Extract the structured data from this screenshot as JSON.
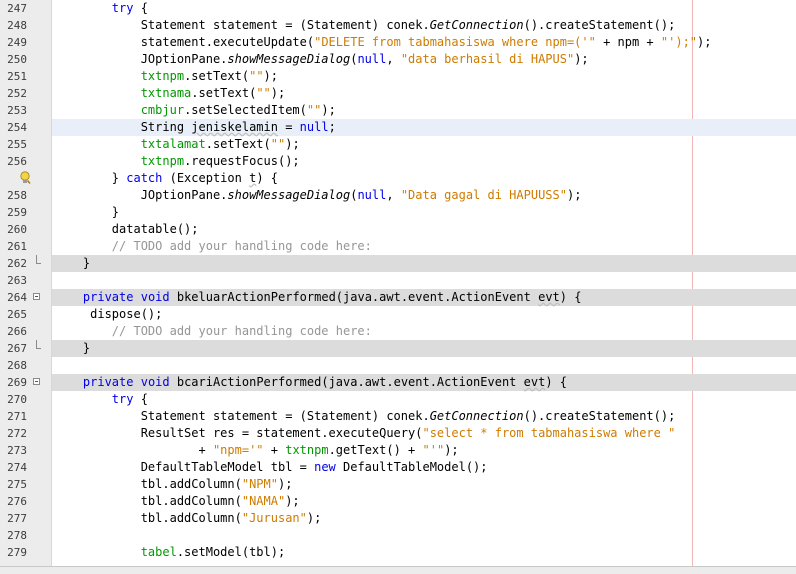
{
  "editor": {
    "lines": [
      {
        "num": "247",
        "fold": "",
        "hl": "",
        "segments": [
          {
            "t": "        "
          },
          {
            "t": "try",
            "c": "kw"
          },
          {
            "t": " {"
          }
        ]
      },
      {
        "num": "248",
        "fold": "",
        "hl": "",
        "segments": [
          {
            "t": "            Statement statement = (Statement) conek."
          },
          {
            "t": "GetConnection",
            "c": "ital"
          },
          {
            "t": "().createStatement();"
          }
        ]
      },
      {
        "num": "249",
        "fold": "",
        "hl": "",
        "segments": [
          {
            "t": "            statement.executeUpdate("
          },
          {
            "t": "\"DELETE from tabmahasiswa where npm=('\"",
            "c": "str"
          },
          {
            "t": " + npm + "
          },
          {
            "t": "\"');\"",
            "c": "str"
          },
          {
            "t": ");"
          }
        ]
      },
      {
        "num": "250",
        "fold": "",
        "hl": "",
        "segments": [
          {
            "t": "            JOptionPane."
          },
          {
            "t": "showMessageDialog",
            "c": "ital"
          },
          {
            "t": "("
          },
          {
            "t": "null",
            "c": "kw"
          },
          {
            "t": ", "
          },
          {
            "t": "\"data berhasil di HAPUS\"",
            "c": "str"
          },
          {
            "t": ");"
          }
        ]
      },
      {
        "num": "251",
        "fold": "",
        "hl": "",
        "segments": [
          {
            "t": "            "
          },
          {
            "t": "txtnpm",
            "c": "fld"
          },
          {
            "t": ".setText("
          },
          {
            "t": "\"\"",
            "c": "str"
          },
          {
            "t": ");"
          }
        ]
      },
      {
        "num": "252",
        "fold": "",
        "hl": "",
        "segments": [
          {
            "t": "            "
          },
          {
            "t": "txtnama",
            "c": "fld"
          },
          {
            "t": ".setText("
          },
          {
            "t": "\"\"",
            "c": "str"
          },
          {
            "t": ");"
          }
        ]
      },
      {
        "num": "253",
        "fold": "",
        "hl": "",
        "segments": [
          {
            "t": "            "
          },
          {
            "t": "cmbjur",
            "c": "fld"
          },
          {
            "t": ".setSelectedItem("
          },
          {
            "t": "\"\"",
            "c": "str"
          },
          {
            "t": ");"
          }
        ]
      },
      {
        "num": "254",
        "fold": "",
        "hl": "current",
        "segments": [
          {
            "t": "            String "
          },
          {
            "t": "jeniskelamin",
            "c": "wavy"
          },
          {
            "t": " = "
          },
          {
            "t": "null",
            "c": "kw"
          },
          {
            "t": ";"
          }
        ]
      },
      {
        "num": "255",
        "fold": "",
        "hl": "",
        "segments": [
          {
            "t": "            "
          },
          {
            "t": "txtalamat",
            "c": "fld"
          },
          {
            "t": ".setText("
          },
          {
            "t": "\"\"",
            "c": "str"
          },
          {
            "t": ");"
          }
        ]
      },
      {
        "num": "256",
        "fold": "",
        "hl": "",
        "segments": [
          {
            "t": "            "
          },
          {
            "t": "txtnpm",
            "c": "fld"
          },
          {
            "t": ".requestFocus();"
          }
        ]
      },
      {
        "num": "",
        "fold": "bulb",
        "hl": "",
        "segments": [
          {
            "t": "        } "
          },
          {
            "t": "catch",
            "c": "kw"
          },
          {
            "t": " (Exception "
          },
          {
            "t": "t",
            "c": "wavy"
          },
          {
            "t": ") {"
          }
        ]
      },
      {
        "num": "258",
        "fold": "",
        "hl": "",
        "segments": [
          {
            "t": "            JOptionPane."
          },
          {
            "t": "showMessageDialog",
            "c": "ital"
          },
          {
            "t": "("
          },
          {
            "t": "null",
            "c": "kw"
          },
          {
            "t": ", "
          },
          {
            "t": "\"Data gagal di HAPUUSS\"",
            "c": "str"
          },
          {
            "t": ");"
          }
        ]
      },
      {
        "num": "259",
        "fold": "",
        "hl": "",
        "segments": [
          {
            "t": "        }"
          }
        ]
      },
      {
        "num": "260",
        "fold": "",
        "hl": "",
        "segments": [
          {
            "t": "        datatable();"
          }
        ]
      },
      {
        "num": "261",
        "fold": "",
        "hl": "",
        "segments": [
          {
            "t": "        "
          },
          {
            "t": "// TODO add your handling code here:",
            "c": "cmt"
          }
        ]
      },
      {
        "num": "262",
        "fold": "end",
        "hl": "gray",
        "segments": [
          {
            "t": "    }"
          }
        ]
      },
      {
        "num": "263",
        "fold": "",
        "hl": "",
        "segments": [
          {
            "t": ""
          }
        ]
      },
      {
        "num": "264",
        "fold": "start",
        "hl": "gray",
        "segments": [
          {
            "t": "    "
          },
          {
            "t": "private",
            "c": "kw"
          },
          {
            "t": " "
          },
          {
            "t": "void",
            "c": "kw"
          },
          {
            "t": " bkeluarActionPerformed(java.awt.event.ActionEvent "
          },
          {
            "t": "evt",
            "c": "wavy"
          },
          {
            "t": ") {"
          }
        ]
      },
      {
        "num": "265",
        "fold": "",
        "hl": "",
        "segments": [
          {
            "t": "     dispose();"
          }
        ]
      },
      {
        "num": "266",
        "fold": "",
        "hl": "",
        "segments": [
          {
            "t": "        "
          },
          {
            "t": "// TODO add your handling code here:",
            "c": "cmt"
          }
        ]
      },
      {
        "num": "267",
        "fold": "end",
        "hl": "gray",
        "segments": [
          {
            "t": "    }"
          }
        ]
      },
      {
        "num": "268",
        "fold": "",
        "hl": "",
        "segments": [
          {
            "t": ""
          }
        ]
      },
      {
        "num": "269",
        "fold": "start",
        "hl": "gray",
        "segments": [
          {
            "t": "    "
          },
          {
            "t": "private",
            "c": "kw"
          },
          {
            "t": " "
          },
          {
            "t": "void",
            "c": "kw"
          },
          {
            "t": " bcariActionPerformed(java.awt.event.ActionEvent "
          },
          {
            "t": "evt",
            "c": "wavy"
          },
          {
            "t": ") {"
          }
        ]
      },
      {
        "num": "270",
        "fold": "",
        "hl": "",
        "segments": [
          {
            "t": "        "
          },
          {
            "t": "try",
            "c": "kw"
          },
          {
            "t": " {"
          }
        ]
      },
      {
        "num": "271",
        "fold": "",
        "hl": "",
        "segments": [
          {
            "t": "            Statement statement = (Statement) conek."
          },
          {
            "t": "GetConnection",
            "c": "ital"
          },
          {
            "t": "().createStatement();"
          }
        ]
      },
      {
        "num": "272",
        "fold": "",
        "hl": "",
        "segments": [
          {
            "t": "            ResultSet res = statement.executeQuery("
          },
          {
            "t": "\"select * from tabmahasiswa where \"",
            "c": "str"
          }
        ]
      },
      {
        "num": "273",
        "fold": "",
        "hl": "",
        "segments": [
          {
            "t": "                    + "
          },
          {
            "t": "\"npm='\"",
            "c": "str"
          },
          {
            "t": " + "
          },
          {
            "t": "txtnpm",
            "c": "fld"
          },
          {
            "t": ".getText() + "
          },
          {
            "t": "\"'\"",
            "c": "str"
          },
          {
            "t": ");"
          }
        ]
      },
      {
        "num": "274",
        "fold": "",
        "hl": "",
        "segments": [
          {
            "t": "            DefaultTableModel tbl = "
          },
          {
            "t": "new",
            "c": "kw"
          },
          {
            "t": " DefaultTableModel();"
          }
        ]
      },
      {
        "num": "275",
        "fold": "",
        "hl": "",
        "segments": [
          {
            "t": "            tbl.addColumn("
          },
          {
            "t": "\"NPM\"",
            "c": "str"
          },
          {
            "t": ");"
          }
        ]
      },
      {
        "num": "276",
        "fold": "",
        "hl": "",
        "segments": [
          {
            "t": "            tbl.addColumn("
          },
          {
            "t": "\"NAMA\"",
            "c": "str"
          },
          {
            "t": ");"
          }
        ]
      },
      {
        "num": "277",
        "fold": "",
        "hl": "",
        "segments": [
          {
            "t": "            tbl.addColumn("
          },
          {
            "t": "\"Jurusan\"",
            "c": "str"
          },
          {
            "t": ");"
          }
        ]
      },
      {
        "num": "278",
        "fold": "",
        "hl": "",
        "segments": [
          {
            "t": ""
          }
        ]
      },
      {
        "num": "279",
        "fold": "",
        "hl": "",
        "segments": [
          {
            "t": "            "
          },
          {
            "t": "tabel",
            "c": "fld"
          },
          {
            "t": ".setModel(tbl);"
          }
        ]
      }
    ]
  }
}
